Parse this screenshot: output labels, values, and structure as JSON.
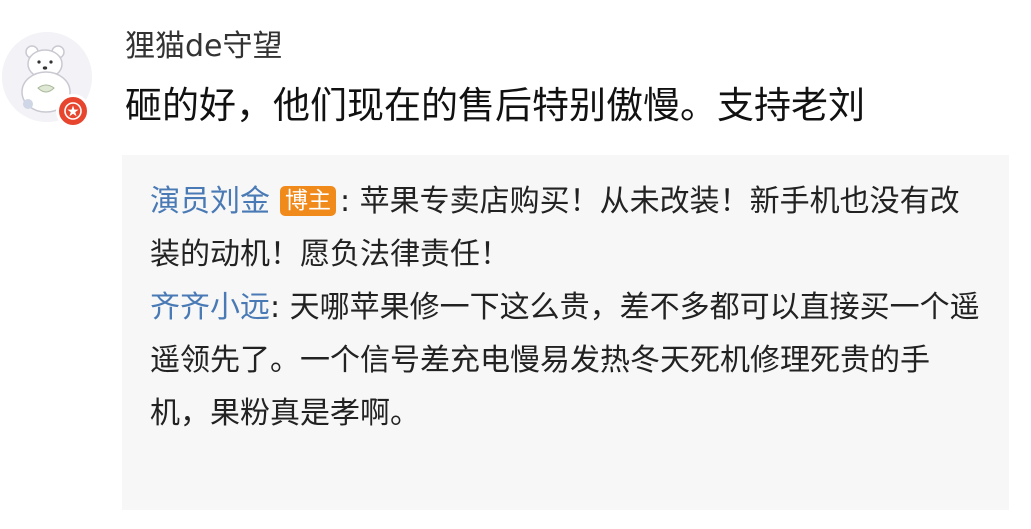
{
  "comment": {
    "username": "狸猫de守望",
    "text": "砸的好，他们现在的售后特别傲慢。支持老刘"
  },
  "replies": [
    {
      "author": "演员刘金",
      "badge": "博主",
      "separator": ":",
      "text": "苹果专卖店购买！从未改装！新手机也没有改装的动机！愿负法律责任！"
    },
    {
      "author": "齐齐小远",
      "separator": ":",
      "text": "天哪苹果修一下这么贵，差不多都可以直接买一个遥遥领先了。一个信号差充电慢易发热冬天死机修理死贵的手机，果粉真是孝啊。"
    }
  ],
  "icons": {
    "avatar": "polar-bear-avatar",
    "verified": "red-star-badge-icon"
  },
  "colors": {
    "author_link": "#4a7ab5",
    "badge_bg": "#f08a1a",
    "verified_bg": "#e8452f",
    "reply_panel_bg": "#f7f7f7"
  }
}
